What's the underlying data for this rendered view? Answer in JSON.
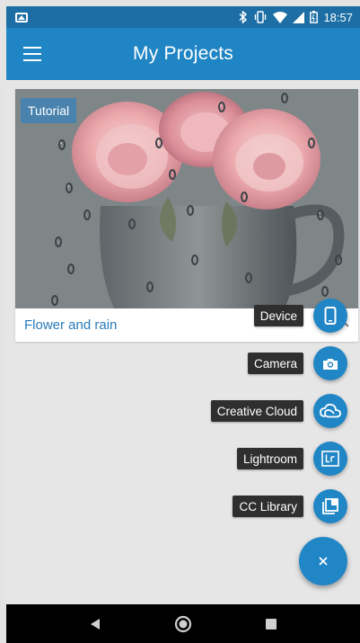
{
  "status_bar": {
    "time": "18:57"
  },
  "app_bar": {
    "title": "My Projects"
  },
  "project_card": {
    "badge": "Tutorial",
    "title": "Flower and rain"
  },
  "fab_menu": {
    "items": [
      {
        "label": "Device",
        "icon": "phone-icon"
      },
      {
        "label": "Camera",
        "icon": "camera-icon"
      },
      {
        "label": "Creative Cloud",
        "icon": "creative-cloud-icon"
      },
      {
        "label": "Lightroom",
        "icon": "lightroom-icon"
      },
      {
        "label": "CC Library",
        "icon": "library-icon"
      }
    ],
    "close_icon": "close-icon"
  },
  "colors": {
    "status_bar": "#1c6ea4",
    "app_bar": "#2085c4",
    "fab": "#2186c6",
    "card_title": "#2a7ab8",
    "label_bg": "#2f2f2f"
  }
}
